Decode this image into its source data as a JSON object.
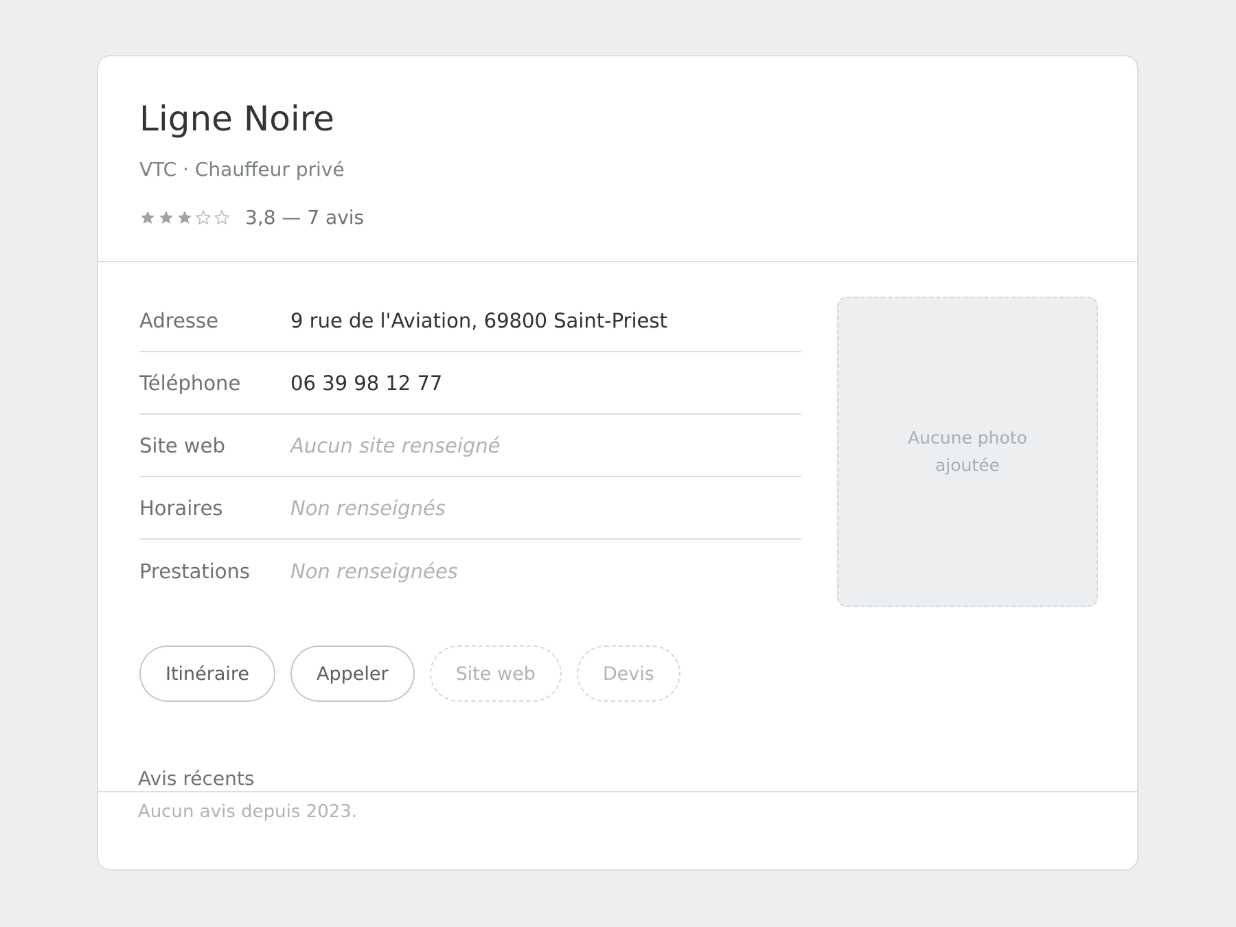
{
  "listing": {
    "name": "Ligne Noire",
    "category": "VTC · Chauffeur privé",
    "rating": {
      "stars_filled": 3,
      "stars_total": 5,
      "text": "3,8 — 7 avis"
    }
  },
  "details": {
    "address_label": "Adresse",
    "address_value": "9 rue de l'Aviation, 69800 Saint-Priest",
    "phone_label": "Téléphone",
    "phone_value": "06 39 98 12 77",
    "website_label": "Site web",
    "website_value": "Aucun site renseigné",
    "hours_label": "Horaires",
    "hours_value": "Non renseignés",
    "services_label": "Prestations",
    "services_value": "Non renseignées"
  },
  "photo": {
    "placeholder": "Aucune photo ajoutée"
  },
  "actions": {
    "itinerary": "Itinéraire",
    "call": "Appeler",
    "website": "Site web",
    "quote": "Devis"
  },
  "reviews": {
    "title": "Avis récents",
    "empty": "Aucun avis depuis 2023."
  },
  "colors": {
    "star_filled": "#9ea3a8",
    "star_empty_outline": "#b8bcc0"
  }
}
